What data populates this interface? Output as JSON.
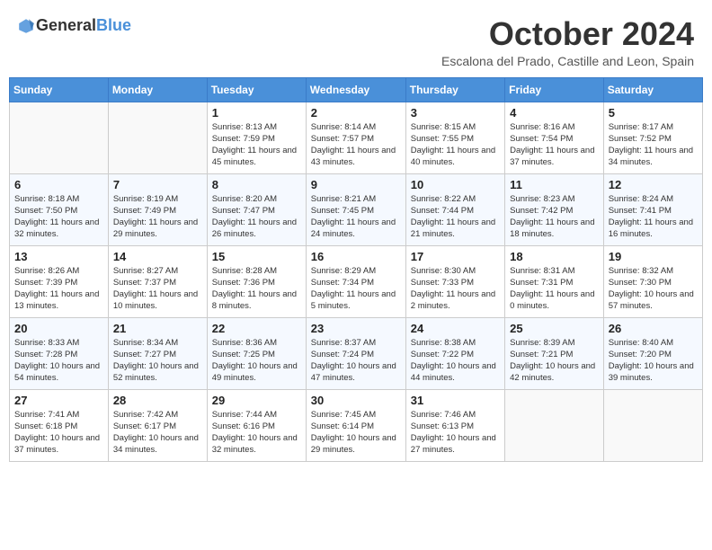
{
  "header": {
    "logo_general": "General",
    "logo_blue": "Blue",
    "month_title": "October 2024",
    "subtitle": "Escalona del Prado, Castille and Leon, Spain"
  },
  "days_of_week": [
    "Sunday",
    "Monday",
    "Tuesday",
    "Wednesday",
    "Thursday",
    "Friday",
    "Saturday"
  ],
  "weeks": [
    [
      {
        "day": "",
        "info": ""
      },
      {
        "day": "",
        "info": ""
      },
      {
        "day": "1",
        "info": "Sunrise: 8:13 AM\nSunset: 7:59 PM\nDaylight: 11 hours and 45 minutes."
      },
      {
        "day": "2",
        "info": "Sunrise: 8:14 AM\nSunset: 7:57 PM\nDaylight: 11 hours and 43 minutes."
      },
      {
        "day": "3",
        "info": "Sunrise: 8:15 AM\nSunset: 7:55 PM\nDaylight: 11 hours and 40 minutes."
      },
      {
        "day": "4",
        "info": "Sunrise: 8:16 AM\nSunset: 7:54 PM\nDaylight: 11 hours and 37 minutes."
      },
      {
        "day": "5",
        "info": "Sunrise: 8:17 AM\nSunset: 7:52 PM\nDaylight: 11 hours and 34 minutes."
      }
    ],
    [
      {
        "day": "6",
        "info": "Sunrise: 8:18 AM\nSunset: 7:50 PM\nDaylight: 11 hours and 32 minutes."
      },
      {
        "day": "7",
        "info": "Sunrise: 8:19 AM\nSunset: 7:49 PM\nDaylight: 11 hours and 29 minutes."
      },
      {
        "day": "8",
        "info": "Sunrise: 8:20 AM\nSunset: 7:47 PM\nDaylight: 11 hours and 26 minutes."
      },
      {
        "day": "9",
        "info": "Sunrise: 8:21 AM\nSunset: 7:45 PM\nDaylight: 11 hours and 24 minutes."
      },
      {
        "day": "10",
        "info": "Sunrise: 8:22 AM\nSunset: 7:44 PM\nDaylight: 11 hours and 21 minutes."
      },
      {
        "day": "11",
        "info": "Sunrise: 8:23 AM\nSunset: 7:42 PM\nDaylight: 11 hours and 18 minutes."
      },
      {
        "day": "12",
        "info": "Sunrise: 8:24 AM\nSunset: 7:41 PM\nDaylight: 11 hours and 16 minutes."
      }
    ],
    [
      {
        "day": "13",
        "info": "Sunrise: 8:26 AM\nSunset: 7:39 PM\nDaylight: 11 hours and 13 minutes."
      },
      {
        "day": "14",
        "info": "Sunrise: 8:27 AM\nSunset: 7:37 PM\nDaylight: 11 hours and 10 minutes."
      },
      {
        "day": "15",
        "info": "Sunrise: 8:28 AM\nSunset: 7:36 PM\nDaylight: 11 hours and 8 minutes."
      },
      {
        "day": "16",
        "info": "Sunrise: 8:29 AM\nSunset: 7:34 PM\nDaylight: 11 hours and 5 minutes."
      },
      {
        "day": "17",
        "info": "Sunrise: 8:30 AM\nSunset: 7:33 PM\nDaylight: 11 hours and 2 minutes."
      },
      {
        "day": "18",
        "info": "Sunrise: 8:31 AM\nSunset: 7:31 PM\nDaylight: 11 hours and 0 minutes."
      },
      {
        "day": "19",
        "info": "Sunrise: 8:32 AM\nSunset: 7:30 PM\nDaylight: 10 hours and 57 minutes."
      }
    ],
    [
      {
        "day": "20",
        "info": "Sunrise: 8:33 AM\nSunset: 7:28 PM\nDaylight: 10 hours and 54 minutes."
      },
      {
        "day": "21",
        "info": "Sunrise: 8:34 AM\nSunset: 7:27 PM\nDaylight: 10 hours and 52 minutes."
      },
      {
        "day": "22",
        "info": "Sunrise: 8:36 AM\nSunset: 7:25 PM\nDaylight: 10 hours and 49 minutes."
      },
      {
        "day": "23",
        "info": "Sunrise: 8:37 AM\nSunset: 7:24 PM\nDaylight: 10 hours and 47 minutes."
      },
      {
        "day": "24",
        "info": "Sunrise: 8:38 AM\nSunset: 7:22 PM\nDaylight: 10 hours and 44 minutes."
      },
      {
        "day": "25",
        "info": "Sunrise: 8:39 AM\nSunset: 7:21 PM\nDaylight: 10 hours and 42 minutes."
      },
      {
        "day": "26",
        "info": "Sunrise: 8:40 AM\nSunset: 7:20 PM\nDaylight: 10 hours and 39 minutes."
      }
    ],
    [
      {
        "day": "27",
        "info": "Sunrise: 7:41 AM\nSunset: 6:18 PM\nDaylight: 10 hours and 37 minutes."
      },
      {
        "day": "28",
        "info": "Sunrise: 7:42 AM\nSunset: 6:17 PM\nDaylight: 10 hours and 34 minutes."
      },
      {
        "day": "29",
        "info": "Sunrise: 7:44 AM\nSunset: 6:16 PM\nDaylight: 10 hours and 32 minutes."
      },
      {
        "day": "30",
        "info": "Sunrise: 7:45 AM\nSunset: 6:14 PM\nDaylight: 10 hours and 29 minutes."
      },
      {
        "day": "31",
        "info": "Sunrise: 7:46 AM\nSunset: 6:13 PM\nDaylight: 10 hours and 27 minutes."
      },
      {
        "day": "",
        "info": ""
      },
      {
        "day": "",
        "info": ""
      }
    ]
  ]
}
